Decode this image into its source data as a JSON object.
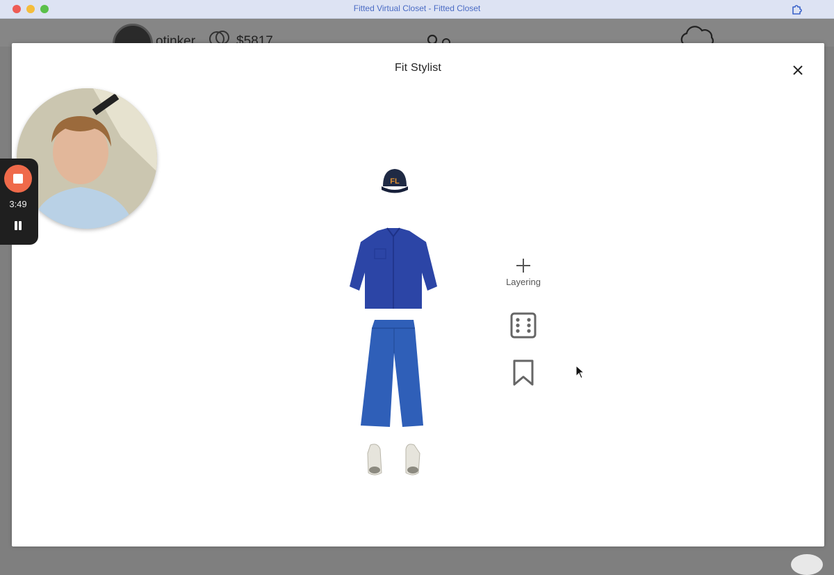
{
  "window": {
    "title": "Fitted Virtual Closet - Fitted Closet"
  },
  "background_page": {
    "username": "otinker",
    "balance": "$5817"
  },
  "modal": {
    "title": "Fit Stylist",
    "actions": {
      "layering_label": "Layering"
    }
  },
  "outfit": {
    "cap_text": "FL",
    "colors": {
      "cap": "#1f2a44",
      "cap_logo": "#e0902f",
      "shirt": "#2c45a6",
      "pants": "#2f5fb8",
      "shoes": "#e6e4dc"
    }
  },
  "recorder": {
    "timer": "3:49",
    "stop_color": "#ef6a4a"
  },
  "icons": {
    "close": "close-icon",
    "add": "plus-icon",
    "dice": "dice-icon",
    "bookmark": "bookmark-icon"
  }
}
